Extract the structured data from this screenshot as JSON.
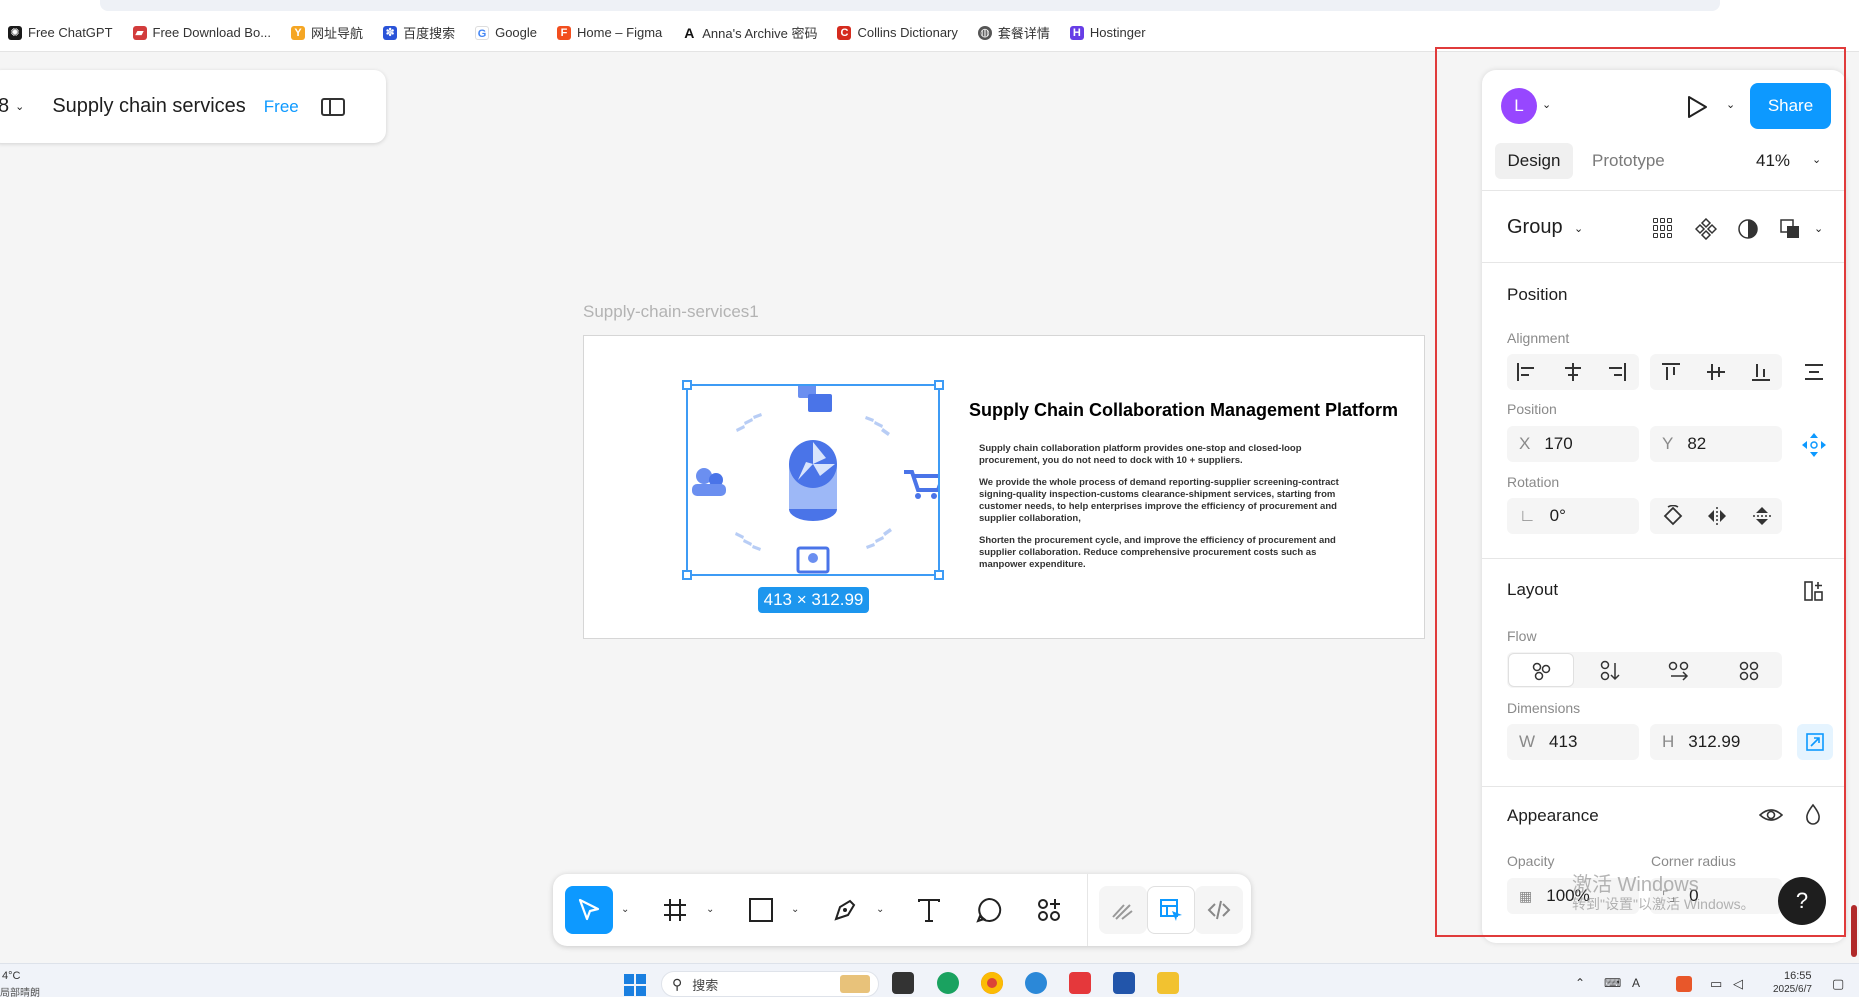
{
  "bookmarks": [
    {
      "label": "Free ChatGPT",
      "icon": "chatgpt-icon",
      "color": "#1a1a1a"
    },
    {
      "label": "Free Download Bo...",
      "icon": "book-icon",
      "color": "#d23c3c"
    },
    {
      "label": "网址导航",
      "icon": "nav-icon",
      "color": "#f5a623"
    },
    {
      "label": "百度搜索",
      "icon": "baidu-icon",
      "color": "#2a53d8"
    },
    {
      "label": "Google",
      "icon": "google-icon",
      "color": "#4285f4"
    },
    {
      "label": "Home – Figma",
      "icon": "figma-icon",
      "color": "#f24e1e"
    },
    {
      "label": "Anna's Archive 密码",
      "icon": "annas-archive-icon",
      "color": "#111111"
    },
    {
      "label": "Collins Dictionary",
      "icon": "collins-icon",
      "color": "#d52b1e"
    },
    {
      "label": "套餐详情",
      "icon": "globe-icon",
      "color": "#555555"
    },
    {
      "label": "Hostinger",
      "icon": "hostinger-icon",
      "color": "#673de6"
    }
  ],
  "file": {
    "title": "Supply chain services",
    "plan": "Free",
    "menu_glyph": "8"
  },
  "frame": {
    "label": "Supply-chain-services1",
    "heading": "Supply Chain Collaboration Management Platform",
    "paragraphs": [
      "Supply chain collaboration platform provides one-stop and closed-loop procurement, you do not need to dock with 10 + suppliers.",
      "We provide the whole process of demand reporting-supplier screening-contract signing-quality inspection-customs clearance-shipment services, starting from customer needs, to help enterprises improve the efficiency of procurement and supplier collaboration,",
      "Shorten the procurement cycle, and improve the efficiency of procurement and supplier collaboration. Reduce comprehensive procurement costs such as manpower expenditure."
    ],
    "selection_size": "413 × 312.99"
  },
  "panel": {
    "avatar": "L",
    "share": "Share",
    "tabs": {
      "design": "Design",
      "prototype": "Prototype"
    },
    "zoom": "41%",
    "group": "Group",
    "position": {
      "title": "Position",
      "alignment": "Alignment",
      "position_label": "Position",
      "x_key": "X",
      "x": "170",
      "y_key": "Y",
      "y": "82",
      "rotation_label": "Rotation",
      "rotation": "0°"
    },
    "layout": {
      "title": "Layout",
      "flow": "Flow",
      "dimensions": "Dimensions",
      "w_key": "W",
      "w": "413",
      "h_key": "H",
      "h": "312.99"
    },
    "appearance": {
      "title": "Appearance",
      "opacity_label": "Opacity",
      "opacity": "100%",
      "radius_label": "Corner radius",
      "radius": "0"
    },
    "help": "?"
  },
  "watermark": {
    "line1": "激活 Windows",
    "line2": "转到\"设置\"以激活 Windows。"
  },
  "taskbar": {
    "weather": "4°C",
    "weather_sub": "局部晴朗",
    "search": "搜索",
    "time": "16:55",
    "date": "2025/6/7"
  },
  "colors": {
    "accent": "#0d99ff",
    "selection": "#3d9bf5",
    "avatar": "#9747ff",
    "highlight": "#e03b3b"
  }
}
